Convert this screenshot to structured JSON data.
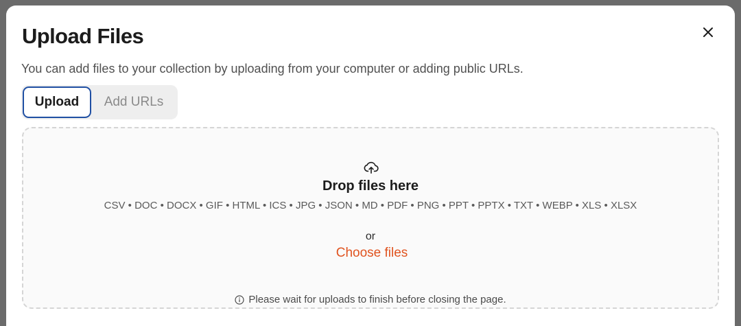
{
  "modal": {
    "title": "Upload Files",
    "subtitle": "You can add files to your collection by uploading from your computer or adding public URLs.",
    "close_icon": "close-icon"
  },
  "tabs": [
    {
      "label": "Upload",
      "active": true
    },
    {
      "label": "Add URLs",
      "active": false
    }
  ],
  "dropzone": {
    "icon": "upload-cloud-icon",
    "title": "Drop files here",
    "formats": "CSV • DOC • DOCX • GIF • HTML • ICS • JPG • JSON • MD • PDF • PNG • PPT • PPTX • TXT • WEBP • XLS • XLSX",
    "or_text": "or",
    "choose_label": "Choose files",
    "notice_icon": "info-icon",
    "notice": "Please wait for uploads to finish before closing the page."
  },
  "colors": {
    "accent": "#e0531f",
    "active_tab_border": "#1f4fa3"
  }
}
